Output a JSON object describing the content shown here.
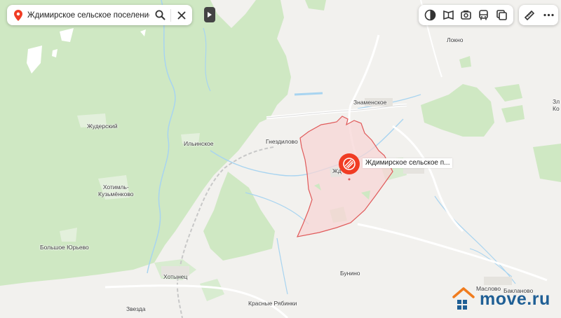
{
  "search": {
    "query": "Ждимирское сельское поселение"
  },
  "toolbar": {
    "icons": [
      "layers-icon",
      "panorama-icon",
      "camera-icon",
      "transport-icon",
      "snapshot-icon"
    ],
    "extra_icons": [
      "ruler-icon",
      "more-icon"
    ]
  },
  "object_label": "Ждимирское сельское п...",
  "colors": {
    "forest": "#cfe8c3",
    "background": "#f2f1ee",
    "water": "#a8d4f0",
    "region_fill": "#f7d6d6",
    "region_stroke": "#e05a5a",
    "pin": "#f03c24",
    "brand": "#1f5f95",
    "brand_accent": "#f07c1e"
  },
  "places": {
    "lokno": "Локно",
    "znamenskoe": "Знаменское",
    "zhuderskiy": "Жудерский",
    "ilinskoe": "Ильинское",
    "gnezdilovo": "Гнездилово",
    "zhd": "Жд",
    "khotimlkuzmenkovo_1": "Хотимль-",
    "khotimlkuzmenkovo_2": "Кузьмёнково",
    "bolshoe_yurevo": "Большое Юрьево",
    "khotynets": "Хотынец",
    "bunino": "Бунино",
    "zvezda": "Звезда",
    "krasnye_rybinki": "Красные Рябинки",
    "maslovo": "Маслово",
    "baklanovo": "Бакланово",
    "edge1": "Зл",
    "edge2": "Ко"
  },
  "brand": {
    "name": "move.ru"
  }
}
